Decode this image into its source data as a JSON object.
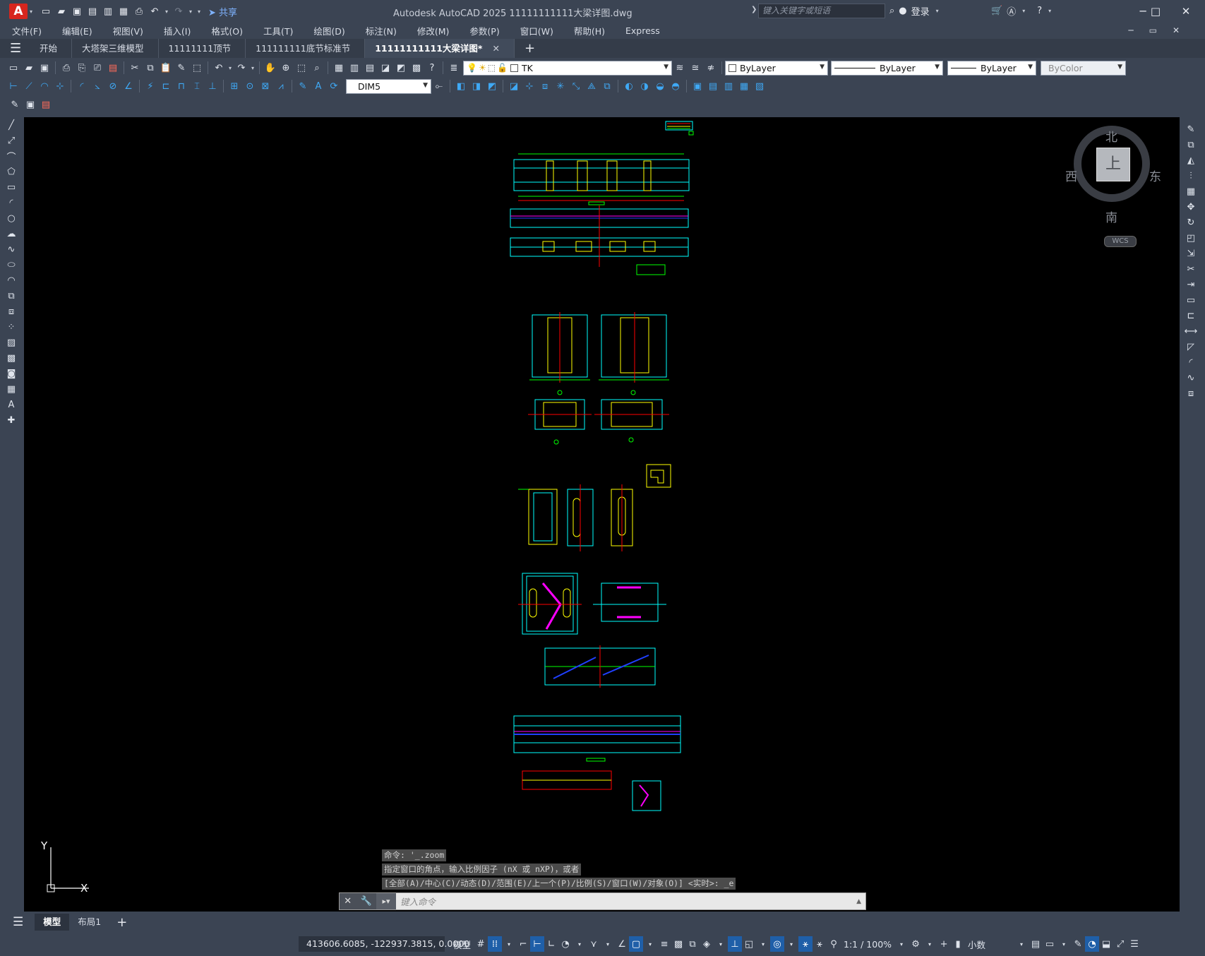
{
  "app": {
    "logo_letter": "A",
    "title": "Autodesk AutoCAD 2025    11111111111大梁详图.dwg",
    "share_label": "共享",
    "search_placeholder": "键入关键字或短语",
    "login_label": "登录"
  },
  "menu": [
    "文件(F)",
    "编辑(E)",
    "视图(V)",
    "插入(I)",
    "格式(O)",
    "工具(T)",
    "绘图(D)",
    "标注(N)",
    "修改(M)",
    "参数(P)",
    "窗口(W)",
    "帮助(H)",
    "Express"
  ],
  "file_tabs": [
    {
      "label": "开始",
      "active": false
    },
    {
      "label": "大塔架三维模型",
      "active": false
    },
    {
      "label": "11111111顶节",
      "active": false
    },
    {
      "label": "111111111底节标准节",
      "active": false
    },
    {
      "label": "11111111111大梁详图*",
      "active": true
    }
  ],
  "layers_toolbar": {
    "layer_name": "TK",
    "color": "ByLayer",
    "linetype": "ByLayer",
    "lineweight": "ByLayer",
    "plotstyle": "ByColor"
  },
  "dim_toolbar": {
    "dimstyle": "DIM5"
  },
  "viewcube": {
    "north": "北",
    "south": "南",
    "east": "东",
    "west": "西",
    "face": "上",
    "wcs": "WCS"
  },
  "ucs": {
    "x": "X",
    "y": "Y"
  },
  "command": {
    "history": [
      "命令: '_.zoom",
      "指定窗口的角点，输入比例因子 (nX 或 nXP)，或者",
      "[全部(A)/中心(C)/动态(D)/范围(E)/上一个(P)/比例(S)/窗口(W)/对象(O)] <实时>: _e"
    ],
    "placeholder": "键入命令"
  },
  "layout_tabs": [
    {
      "label": "模型",
      "active": true
    },
    {
      "label": "布局1",
      "active": false
    }
  ],
  "status": {
    "coords": "413606.6085, -122937.3815, 0.0000",
    "model": "模型",
    "scale": "1:1 / 100%",
    "units": "小数"
  },
  "colors": {
    "canvas": "#000000",
    "cyan": "#00ffff",
    "green": "#00ff00",
    "yellow": "#ffff00",
    "red": "#ff0000",
    "magenta": "#ff00ff",
    "blue": "#2040ff"
  }
}
